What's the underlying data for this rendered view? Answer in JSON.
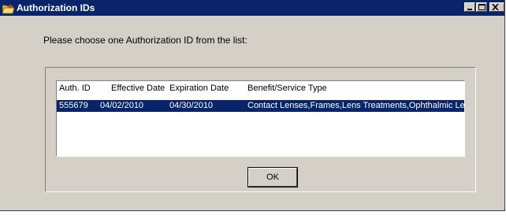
{
  "window": {
    "title": "Authorization IDs",
    "controls": {
      "minimize": "minimize",
      "maximize": "maximize",
      "close": "close"
    }
  },
  "prompt": "Please choose one Authorization ID from the list:",
  "list": {
    "columns": [
      "Auth. ID",
      "Effective Date",
      "Expiration Date",
      "Benefit/Service Type"
    ],
    "rows": [
      {
        "auth_id": "555679",
        "effective_date": "04/02/2010",
        "expiration_date": "04/30/2010",
        "benefit_type": "Contact Lenses,Frames,Lens Treatments,Ophthalmic Le",
        "selected": true
      }
    ]
  },
  "ok_button": {
    "label": "OK"
  },
  "colors": {
    "title_bar": "#0a246a",
    "dialog_face": "#d4d0c8",
    "selection": "#0a246a",
    "selection_text": "#ffffff"
  },
  "icons": {
    "app": "folder-key-icon",
    "minimize": "minimize-icon",
    "maximize": "maximize-icon",
    "close": "close-icon"
  }
}
